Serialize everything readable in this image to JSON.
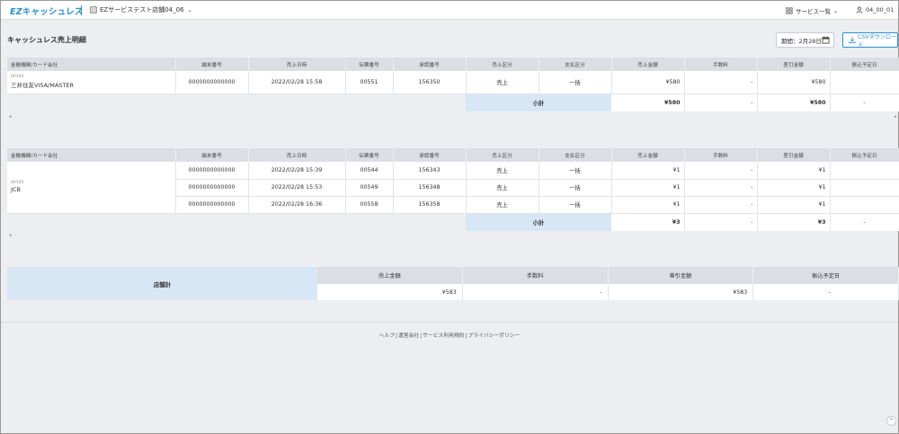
{
  "header": {
    "logo_ez": "EZ",
    "logo_text": "キャッシュレス",
    "store_name": "EZサービステスト店舗04_06",
    "services_label": "サービス一覧",
    "user_label": "04_00_01"
  },
  "page": {
    "title": "キャッシュレス売上明細",
    "period_label": "期間：2月28日",
    "csv_label": "CSVダウンロード"
  },
  "columns": [
    "金融機関/カード会社",
    "端末番号",
    "売上日時",
    "伝票番号",
    "承認番号",
    "売上区分",
    "支払区分",
    "売上金額",
    "手数料",
    "差引金額",
    "振込予定日"
  ],
  "groups": [
    {
      "code": "00104",
      "company": "三井住友VISA/MASTER",
      "rows": [
        {
          "terminal": "0000000000000",
          "datetime": "2022/02/28 15:58",
          "slip": "00551",
          "approval": "156350",
          "sale_type": "売上",
          "pay_type": "一括",
          "amount": "¥580",
          "fee": "-",
          "net": "¥580",
          "transfer": ""
        }
      ],
      "subtotal": {
        "label": "小計",
        "amount": "¥580",
        "fee": "-",
        "net": "¥580",
        "transfer": "-"
      }
    },
    {
      "code": "00105",
      "company": "JCB",
      "rows": [
        {
          "terminal": "0000000000000",
          "datetime": "2022/02/28 15:39",
          "slip": "00544",
          "approval": "156343",
          "sale_type": "売上",
          "pay_type": "一括",
          "amount": "¥1",
          "fee": "-",
          "net": "¥1",
          "transfer": ""
        },
        {
          "terminal": "0000000000000",
          "datetime": "2022/02/28 15:53",
          "slip": "00549",
          "approval": "156348",
          "sale_type": "売上",
          "pay_type": "一括",
          "amount": "¥1",
          "fee": "-",
          "net": "¥1",
          "transfer": ""
        },
        {
          "terminal": "0000000000000",
          "datetime": "2022/02/28 16:36",
          "slip": "00558",
          "approval": "156358",
          "sale_type": "売上",
          "pay_type": "一括",
          "amount": "¥1",
          "fee": "-",
          "net": "¥1",
          "transfer": ""
        }
      ],
      "subtotal": {
        "label": "小計",
        "amount": "¥3",
        "fee": "-",
        "net": "¥3",
        "transfer": "-"
      }
    }
  ],
  "store_total": {
    "label": "店舗計",
    "headers": [
      "売上金額",
      "手数料",
      "差引金額",
      "振込予定日"
    ],
    "values": [
      "¥583",
      "-",
      "¥583",
      "-"
    ]
  },
  "footer": {
    "links": [
      "ヘルプ",
      "運営会社",
      "サービス利用規約",
      "プライバシーポリシー"
    ]
  },
  "icons": {
    "store": "building-icon",
    "services": "grid-icon",
    "user": "user-icon",
    "calendar": "calendar-icon",
    "download": "download-icon",
    "scroll_top": "arrow-up-icon"
  },
  "colors": {
    "brand": "#2a8fd6",
    "subtotal_bg": "#d7e7f6",
    "header_bg": "#dcdee3"
  }
}
